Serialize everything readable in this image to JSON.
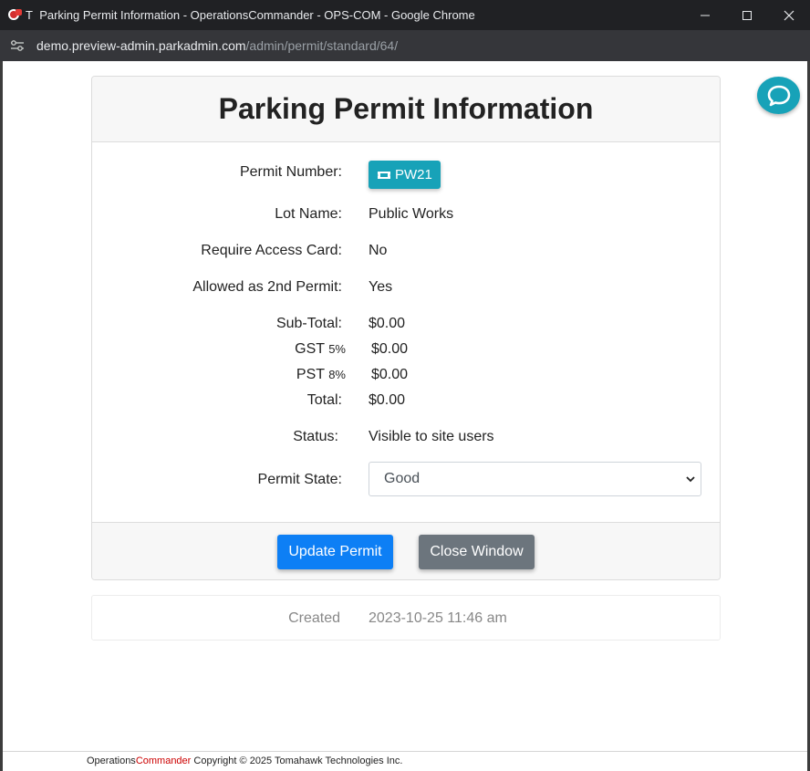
{
  "window": {
    "title": "Parking Permit Information - OperationsCommander - OPS-COM - Google Chrome",
    "favicon_letter": "T",
    "url_host": "demo.preview-admin.parkadmin.com",
    "url_path": "/admin/permit/standard/64/"
  },
  "card": {
    "title": "Parking Permit Information"
  },
  "fields": {
    "permit_number_label": "Permit Number:",
    "permit_number_value": "PW21",
    "lot_name_label": "Lot Name:",
    "lot_name_value": "Public Works",
    "access_card_label": "Require Access Card:",
    "access_card_value": "No",
    "second_permit_label": "Allowed as 2nd Permit:",
    "second_permit_value": "Yes",
    "subtotal_label": "Sub-Total:",
    "subtotal_value": "$0.00",
    "gst_label": "GST",
    "gst_rate": "5%",
    "gst_value": "$0.00",
    "pst_label": "PST",
    "pst_rate": "8%",
    "pst_value": "$0.00",
    "total_label": "Total:",
    "total_value": "$0.00",
    "status_label": "Status:",
    "status_value": "Visible to site users",
    "permit_state_label": "Permit State:",
    "permit_state_value": "Good"
  },
  "buttons": {
    "update": "Update Permit",
    "close": "Close Window"
  },
  "created": {
    "label": "Created",
    "value": "2023-10-25 11:46 am"
  },
  "footer": {
    "brand_a": "Operations",
    "brand_b": "Commander",
    "copyright": " Copyright © 2025 Tomahawk Technologies Inc."
  },
  "colors": {
    "accent": "#17a2b8",
    "primary": "#0d7ff5",
    "secondary": "#6c757d"
  }
}
